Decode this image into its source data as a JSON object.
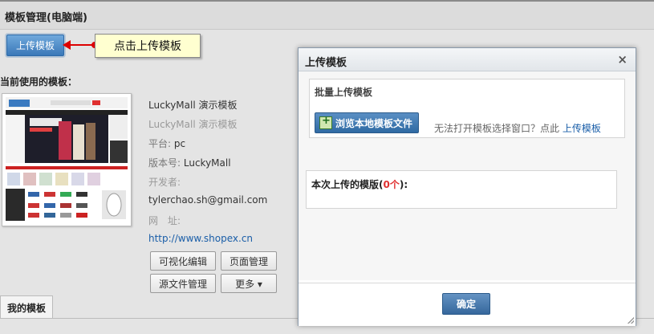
{
  "page": {
    "title": "模板管理(电脑端)",
    "upload_button": "上传模板",
    "callout": "点击上传模板",
    "current_label": "当前使用的模板：",
    "template": {
      "name": "LuckyMall 演示模板",
      "description": "LuckyMall 演示模板",
      "platform_label": "平台:",
      "platform": "pc",
      "version_label": "版本号:",
      "version": "LuckyMall",
      "developer_label": "开发者:",
      "developer": "tylerchao.sh@gmail.com",
      "url_label": "网　址:",
      "url": "http://www.shopex.cn"
    },
    "actions": {
      "visual_edit": "可视化编辑",
      "page_manage": "页面管理",
      "source_manage": "源文件管理",
      "more": "更多 ▾"
    },
    "tab": "我的模板"
  },
  "modal": {
    "title": "上传模板",
    "close": "×",
    "batch_label": "批量上传模板",
    "browse_button": "浏览本地模板文件",
    "cannot_open": "无法打开模板选择窗口？点此",
    "upload_link": "上传模板",
    "list_title_prefix": "本次上传的模版(",
    "list_count": "0个",
    "list_title_suffix": "):",
    "ok_button": "确定"
  },
  "colors": {
    "accent": "#3a78b8",
    "callout_bg": "#ffffd0",
    "arrow": "#dd0000",
    "link": "#1a5ea8",
    "count": "#e03030"
  }
}
